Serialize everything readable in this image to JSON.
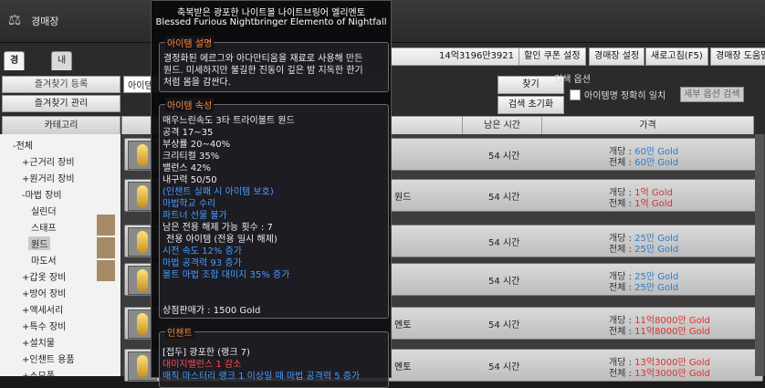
{
  "window": {
    "title": "경매장"
  },
  "tabs": [
    "경매장",
    "내 경매"
  ],
  "topbar": {
    "money": "14억3196만3921",
    "buttons": [
      "할인 쿠폰 설정",
      "경매장 설정",
      "새로고침(F5)",
      "경매장 도움말"
    ]
  },
  "favorites": {
    "add_label": "즐겨찾기 등록",
    "manage_label": "즐겨찾기 관리"
  },
  "search": {
    "value": "아이템",
    "search_label": "찾기",
    "reset_label": "검색 초기화",
    "options_label": "검색 옵션",
    "exact_match_label": "아이템명 정확히 일치",
    "detail_options_label": "세부 옵션 검색"
  },
  "headers": {
    "category": "카테고리",
    "remaining_time": "남은 시간",
    "price": "가격"
  },
  "categories": [
    {
      "label": "-전체"
    },
    {
      "label": "+근거리 장비"
    },
    {
      "label": "+원거리 장비"
    },
    {
      "label": "-마법 장비"
    },
    {
      "label": "실린더"
    },
    {
      "label": "스태프"
    },
    {
      "label": "원드"
    },
    {
      "label": "마도서"
    },
    {
      "label": "+갑옷 장비"
    },
    {
      "label": "+방어 장비"
    },
    {
      "label": "+액세서리"
    },
    {
      "label": "+특수 장비"
    },
    {
      "label": "+설치물"
    },
    {
      "label": "+인챈트 용품"
    },
    {
      "label": "+소모품"
    }
  ],
  "rows": [
    {
      "name": "",
      "time": "54 시간",
      "unit_label": "개당 :",
      "unit_price": "60만 Gold",
      "total_label": "전체 :",
      "total_price": "60만 Gold",
      "color": "#2a7cc9"
    },
    {
      "name": "원드",
      "time": "54 시간",
      "unit_label": "개당 :",
      "unit_price": "1억 Gold",
      "total_label": "전체 :",
      "total_price": "1억 Gold",
      "color": "#d9302c"
    },
    {
      "name": "",
      "time": "54 시간",
      "unit_label": "개당 :",
      "unit_price": "25만 Gold",
      "total_label": "전체 :",
      "total_price": "25만 Gold",
      "color": "#2a7cc9"
    },
    {
      "name": "",
      "time": "54 시간",
      "unit_label": "개당 :",
      "unit_price": "25만 Gold",
      "total_label": "전체 :",
      "total_price": "25만 Gold",
      "color": "#2a7cc9"
    },
    {
      "name": "멘토",
      "time": "54 시간",
      "unit_label": "개당 :",
      "unit_price": "11억8000만 Gold",
      "total_label": "전체 :",
      "total_price": "11억8000만 Gold",
      "color": "#d9302c"
    },
    {
      "name": "멘토",
      "time": "54 시간",
      "unit_label": "개당 :",
      "unit_price": "13억3000만 Gold",
      "total_label": "전체 :",
      "total_price": "13억3000만 Gold",
      "color": "#d9302c"
    }
  ],
  "tooltip": {
    "name_ko": "축복받은 광포한 나이트볼 나이트브링어 엘리멘토",
    "name_en": "Blessed Furious Nightbringer Elemento of Nightfall",
    "desc_title": "아이템 설명",
    "desc_lines": [
      "결정화된 에르그와 아다만티움을 재료로 사용해 만든",
      "원드. 미세하지만 불길한 진동이 깊은 밤 지독한 한기",
      "처럼 몸을 감싼다."
    ],
    "attr_title": "아이템 속성",
    "attr_lines": [
      {
        "text": "매우느린속도 3타 트라이볼트 원드",
        "color": "white"
      },
      {
        "text": "공격 17~35",
        "color": "white"
      },
      {
        "text": "부상률 20~40%",
        "color": "white"
      },
      {
        "text": "크리티컬 35%",
        "color": "white"
      },
      {
        "text": "밸런스 42%",
        "color": "white"
      },
      {
        "text": "내구력 50/50",
        "color": "white"
      },
      {
        "text": "(인챈트 실패 시 아이템 보호)",
        "color": "blue"
      },
      {
        "text": "마법학교 수리",
        "color": "blue"
      },
      {
        "text": "파트너 선물 불가",
        "color": "blue"
      },
      {
        "text": "남은 전용 해제 가능 횟수 : 7",
        "color": "white"
      },
      {
        "text": "전용 아이템 (전용 일시 해제)",
        "color": "white"
      },
      {
        "text": "시전 속도 12% 증가",
        "color": "blue"
      },
      {
        "text": "마법 공격력 93 증가",
        "color": "blue"
      },
      {
        "text": "볼트 마법 조합 대미지 35% 증가",
        "color": "blue"
      }
    ],
    "shop_price": "상점판매가 : 1500 Gold",
    "enchant_title": "인챈트",
    "enchant_lines": [
      {
        "text": "[접두] 광포한 (랭크 7)",
        "color": "white"
      },
      {
        "text": "대미지밸런스 1 감소",
        "color": "red"
      },
      {
        "text": "매직 마스터리 랭크 1 이상일 때 마법 공격력 5 증가",
        "color": "blue"
      }
    ]
  }
}
